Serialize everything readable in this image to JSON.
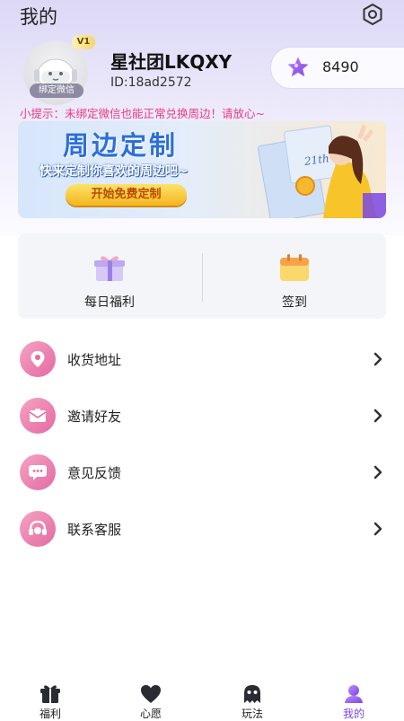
{
  "header": {
    "title": "我的"
  },
  "profile": {
    "vip_label": "V1",
    "bind_label": "绑定微信",
    "username": "星社团LKQXY",
    "user_id": "ID:18ad2572",
    "points": "8490"
  },
  "tip": "小提示：未绑定微信也能正常兑换周边！请放心~",
  "banner": {
    "title": "周边定制",
    "subtitle": "快来定制你喜欢的周边吧~",
    "button": "开始免费定制",
    "art_text": "21th"
  },
  "quick_actions": [
    {
      "label": "每日福利",
      "icon": "gift-icon"
    },
    {
      "label": "签到",
      "icon": "calendar-icon"
    }
  ],
  "menu": [
    {
      "label": "收货地址",
      "icon": "location-icon"
    },
    {
      "label": "邀请好友",
      "icon": "mail-icon"
    },
    {
      "label": "意见反馈",
      "icon": "chat-icon"
    },
    {
      "label": "联系客服",
      "icon": "headset-icon"
    }
  ],
  "bottom_nav": [
    {
      "label": "福利",
      "icon": "gift-icon",
      "active": false
    },
    {
      "label": "心愿",
      "icon": "heart-icon",
      "active": false
    },
    {
      "label": "玩法",
      "icon": "ghost-icon",
      "active": false
    },
    {
      "label": "我的",
      "icon": "user-icon",
      "active": true
    }
  ],
  "colors": {
    "accent": "#7a47e6",
    "tip": "#ec3a86",
    "menu_icon_bg": "#e26aa3"
  }
}
